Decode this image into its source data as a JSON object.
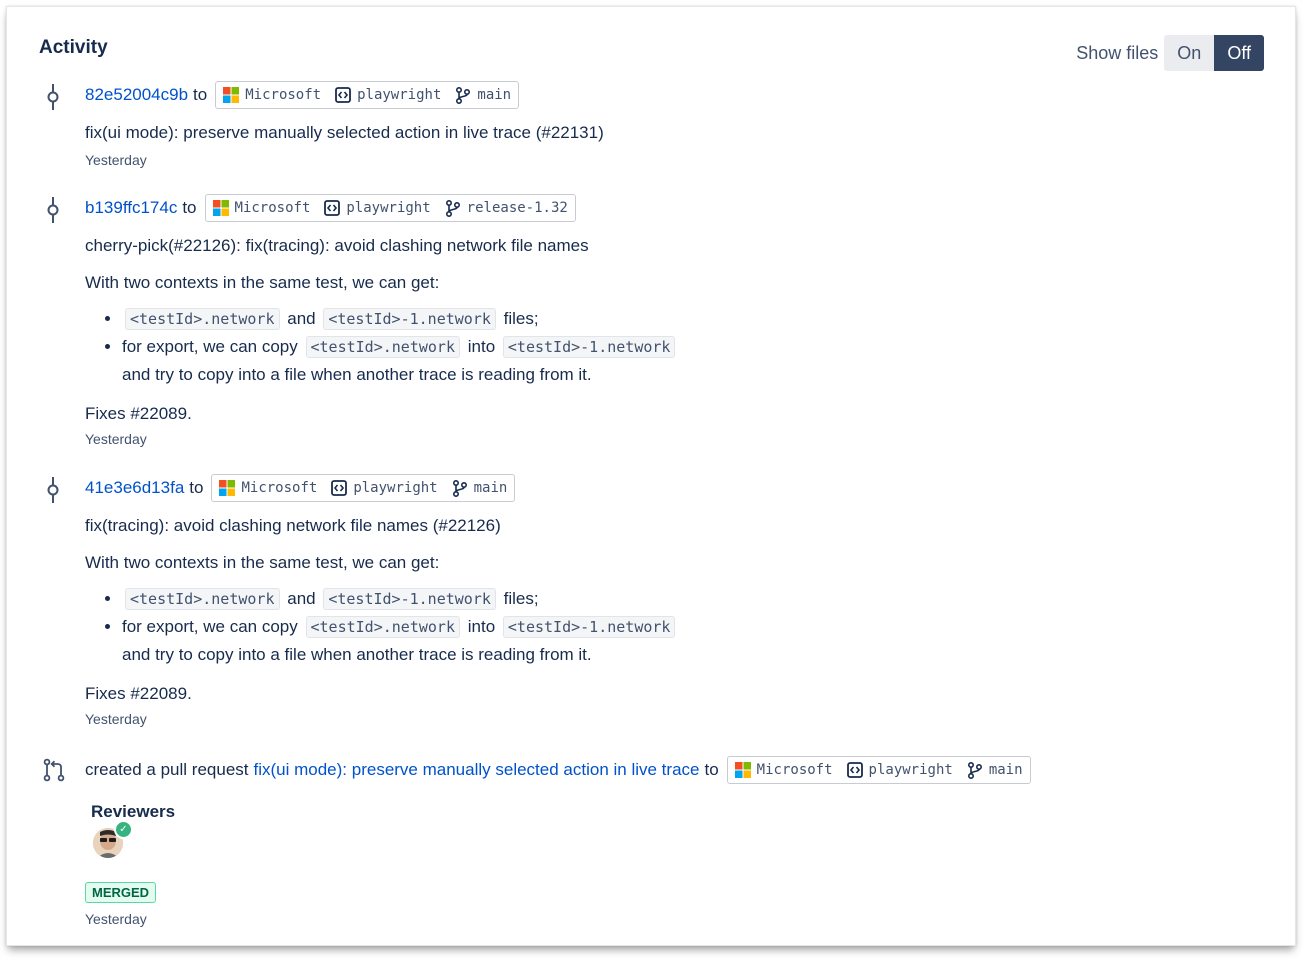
{
  "activity": {
    "title": "Activity",
    "show_files": {
      "label": "Show files",
      "on": "On",
      "off": "Off",
      "selected": "Off"
    }
  },
  "entries": [
    {
      "hash": "82e52004c9b",
      "to": "to",
      "org": "Microsoft",
      "repo": "playwright",
      "branch": "main",
      "message": "fix(ui mode): preserve manually selected action in live trace (#22131)",
      "time": "Yesterday"
    },
    {
      "hash": "b139ffc174c",
      "to": "to",
      "org": "Microsoft",
      "repo": "playwright",
      "branch": "release-1.32",
      "message": "cherry-pick(#22126): fix(tracing): avoid clashing network file names",
      "intro": "With two contexts in the same test, we can get:",
      "bullet1": {
        "code1": "<testId>.network",
        "and": "and",
        "code2": "<testId>-1.network",
        "end": "files;"
      },
      "bullet2": {
        "pre": "for export, we can copy",
        "code1": "<testId>.network",
        "into": "into",
        "code2": "<testId>-1.network",
        "cont": "and try to copy into a file when another trace is reading from it."
      },
      "fixes": "Fixes #22089.",
      "time": "Yesterday"
    },
    {
      "hash": "41e3e6d13fa",
      "to": "to",
      "org": "Microsoft",
      "repo": "playwright",
      "branch": "main",
      "message": "fix(tracing): avoid clashing network file names (#22126)",
      "intro": "With two contexts in the same test, we can get:",
      "bullet1": {
        "code1": "<testId>.network",
        "and": "and",
        "code2": "<testId>-1.network",
        "end": "files;"
      },
      "bullet2": {
        "pre": "for export, we can copy",
        "code1": "<testId>.network",
        "into": "into",
        "code2": "<testId>-1.network",
        "cont": "and try to copy into a file when another trace is reading from it."
      },
      "fixes": "Fixes #22089.",
      "time": "Yesterday"
    }
  ],
  "pull_request": {
    "prefix": "created a pull request",
    "title": "fix(ui mode): preserve manually selected action in live trace",
    "to": "to",
    "org": "Microsoft",
    "repo": "playwright",
    "branch": "main",
    "reviewers_label": "Reviewers",
    "status": "MERGED",
    "time": "Yesterday"
  },
  "colors": {
    "link": "#0052cc",
    "toggle_active": "#344563",
    "merged_green": "#006644",
    "approved": "#36b37e"
  }
}
